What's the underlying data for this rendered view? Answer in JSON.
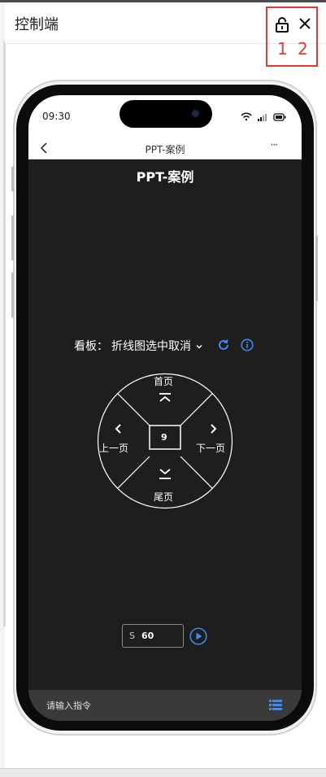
{
  "header": {
    "title": "控制端",
    "markers": [
      "1",
      "2"
    ]
  },
  "phone": {
    "status_time": "09:30",
    "nav_title": "PPT-案例",
    "nav_more": "···"
  },
  "app": {
    "title": "PPT-案例",
    "board_label": "看板：",
    "board_value": "折线图选中取消",
    "wheel": {
      "top_label": "首页",
      "left_label": "上一页",
      "right_label": "下一页",
      "bottom_label": "尾页",
      "center_value": "9"
    },
    "seconds_prefix": "S",
    "seconds_value": "60",
    "command_placeholder": "请输入指令"
  },
  "colors": {
    "accent_blue": "#3d8bf2",
    "marker_red": "#e53935",
    "app_bg": "#1e1e1e",
    "cmd_bar_bg": "#3a3a3a"
  },
  "icons": [
    "lock-icon",
    "close-icon",
    "back-chevron-icon",
    "wifi-icon",
    "signal-icon",
    "battery-icon",
    "chevron-down-icon",
    "refresh-icon",
    "info-icon",
    "double-chevron-up-icon",
    "chevron-left-icon",
    "chevron-right-icon",
    "double-chevron-down-icon",
    "play-icon",
    "list-menu-icon"
  ]
}
